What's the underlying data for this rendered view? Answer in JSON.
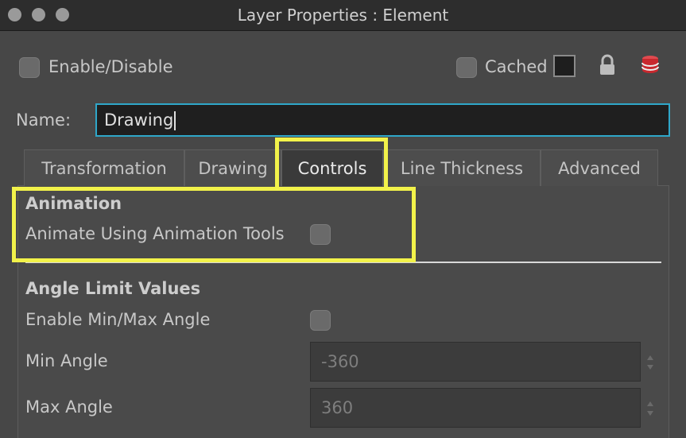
{
  "window": {
    "title": "Layer Properties : Element"
  },
  "header": {
    "enable_label": "Enable/Disable",
    "cached_label": "Cached"
  },
  "name_field": {
    "label": "Name:",
    "value": "Drawing"
  },
  "tabs": [
    {
      "label": "Transformation"
    },
    {
      "label": "Drawing"
    },
    {
      "label": "Controls"
    },
    {
      "label": "Line Thickness"
    },
    {
      "label": "Advanced"
    }
  ],
  "active_tab": "Controls",
  "animation": {
    "title": "Animation",
    "animate_label": "Animate Using Animation Tools"
  },
  "angle_limits": {
    "title": "Angle Limit Values",
    "enable_label": "Enable Min/Max Angle",
    "min_label": "Min Angle",
    "min_value": "-360",
    "max_label": "Max Angle",
    "max_value": "360"
  },
  "colors": {
    "highlight": "#f2f24a",
    "input_focus": "#2fa7c9",
    "db_icon": "#c8282e"
  },
  "icons": [
    "lock-icon",
    "database-icon",
    "spinner-arrows-icon"
  ]
}
